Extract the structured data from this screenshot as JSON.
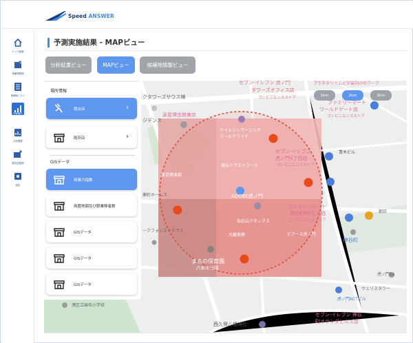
{
  "brand": {
    "prefix": "Speed",
    "name": "ANSWER"
  },
  "sidebar": {
    "items": [
      {
        "label": "トップ画面",
        "icon": "home-icon"
      },
      {
        "label": "情報物登録",
        "icon": "building-add-icon"
      },
      {
        "label": "候補地リスト",
        "icon": "list-icon"
      },
      {
        "label": "分析実行",
        "icon": "analysis-chart-icon"
      },
      {
        "label": "分析履歴",
        "icon": "calendar-chart-icon"
      },
      {
        "label": "既存店登録",
        "icon": "store-add-icon"
      },
      {
        "label": "設定",
        "icon": "settings-icon"
      }
    ],
    "active_index": 3
  },
  "page": {
    "title": "予測実施結果 - MAPビュー"
  },
  "tabs": [
    {
      "label": "分析結果ビュー"
    },
    {
      "label": "MAPビュー"
    },
    {
      "label": "候補地情報ビュー"
    }
  ],
  "range_buttons": [
    "1km",
    "2km",
    "3km"
  ],
  "range_active_index": 1,
  "panel": {
    "section1": "場所情報",
    "section2": "GISデータ",
    "items": [
      {
        "label": "競合店",
        "icon": "competitor-icon",
        "selected": true,
        "chevron": "›"
      },
      {
        "label": "既存店",
        "icon": "store-icon",
        "selected": false,
        "chevron": "›"
      },
      {
        "label": "商業力指数",
        "icon": "store-icon",
        "selected": true
      },
      {
        "label": "商圏地図及び駅乗降者数",
        "icon": "store-icon",
        "selected": false
      },
      {
        "label": "GISデータ",
        "icon": "store-icon",
        "selected": false
      },
      {
        "label": "GISデータ",
        "icon": "store-icon",
        "selected": false
      },
      {
        "label": "GISデータ",
        "icon": "store-icon",
        "selected": false
      }
    ]
  },
  "map": {
    "labels": {
      "seven_toranomon_towers": "セブン-イレブン 虎ノ門",
      "towers_office": "タワーズオフィス店",
      "conv1": "コンビニエンスストア",
      "planetarium": "プラネタリウムと字宙向けのワーク",
      "famima_world": "ファミリーマート",
      "world_gate": "ワールドゲート店",
      "conv2": "コンビニエンスストア",
      "towers_club": "クタワーズサウス棟",
      "sen_oku": "泉屋博古館東京",
      "residence": "ジデンス",
      "wilson": "ウイルソンラーニング",
      "worldwide": "ワールドワイド",
      "seven_toranomon4": "セブン-イレブン",
      "toranomon4": "虎ノ門4丁目店",
      "conv3": "コンビニエンスストア",
      "aoki": "青木ビル",
      "shiroyama": "城山トラストコート",
      "tokyo_club": "東京倶楽部",
      "park_homes": "薬町ホームズ",
      "adobe": "ADOBE虎ノ門",
      "famima_kamiya": "ファミリーマート",
      "kamiya_mt": "神谷町MTビル店",
      "conv4": "コンビニエンスストア",
      "asahi": "朝日",
      "sengoku": "仙石山アネックス",
      "forest_terrace": "ークフォレストテラス",
      "okura": "大蔵茶寮",
      "piers": "ピアース虎ノ門",
      "kamiyacho": "神谷町",
      "nursery1": "まるの保育園",
      "nursery2": "六本木分園",
      "toranomon_e": "虎ノ門Ea",
      "wellus": "ウェリスタワー",
      "act": "虎ノ門ACTビル",
      "azabu_school": "港区立麻布小学校",
      "nishikubo": "西久保八幡神社",
      "seven_kamiya": "セブン-イレブン 神谷",
      "kamiya_orange": "町オランダヒルズ店"
    }
  }
}
